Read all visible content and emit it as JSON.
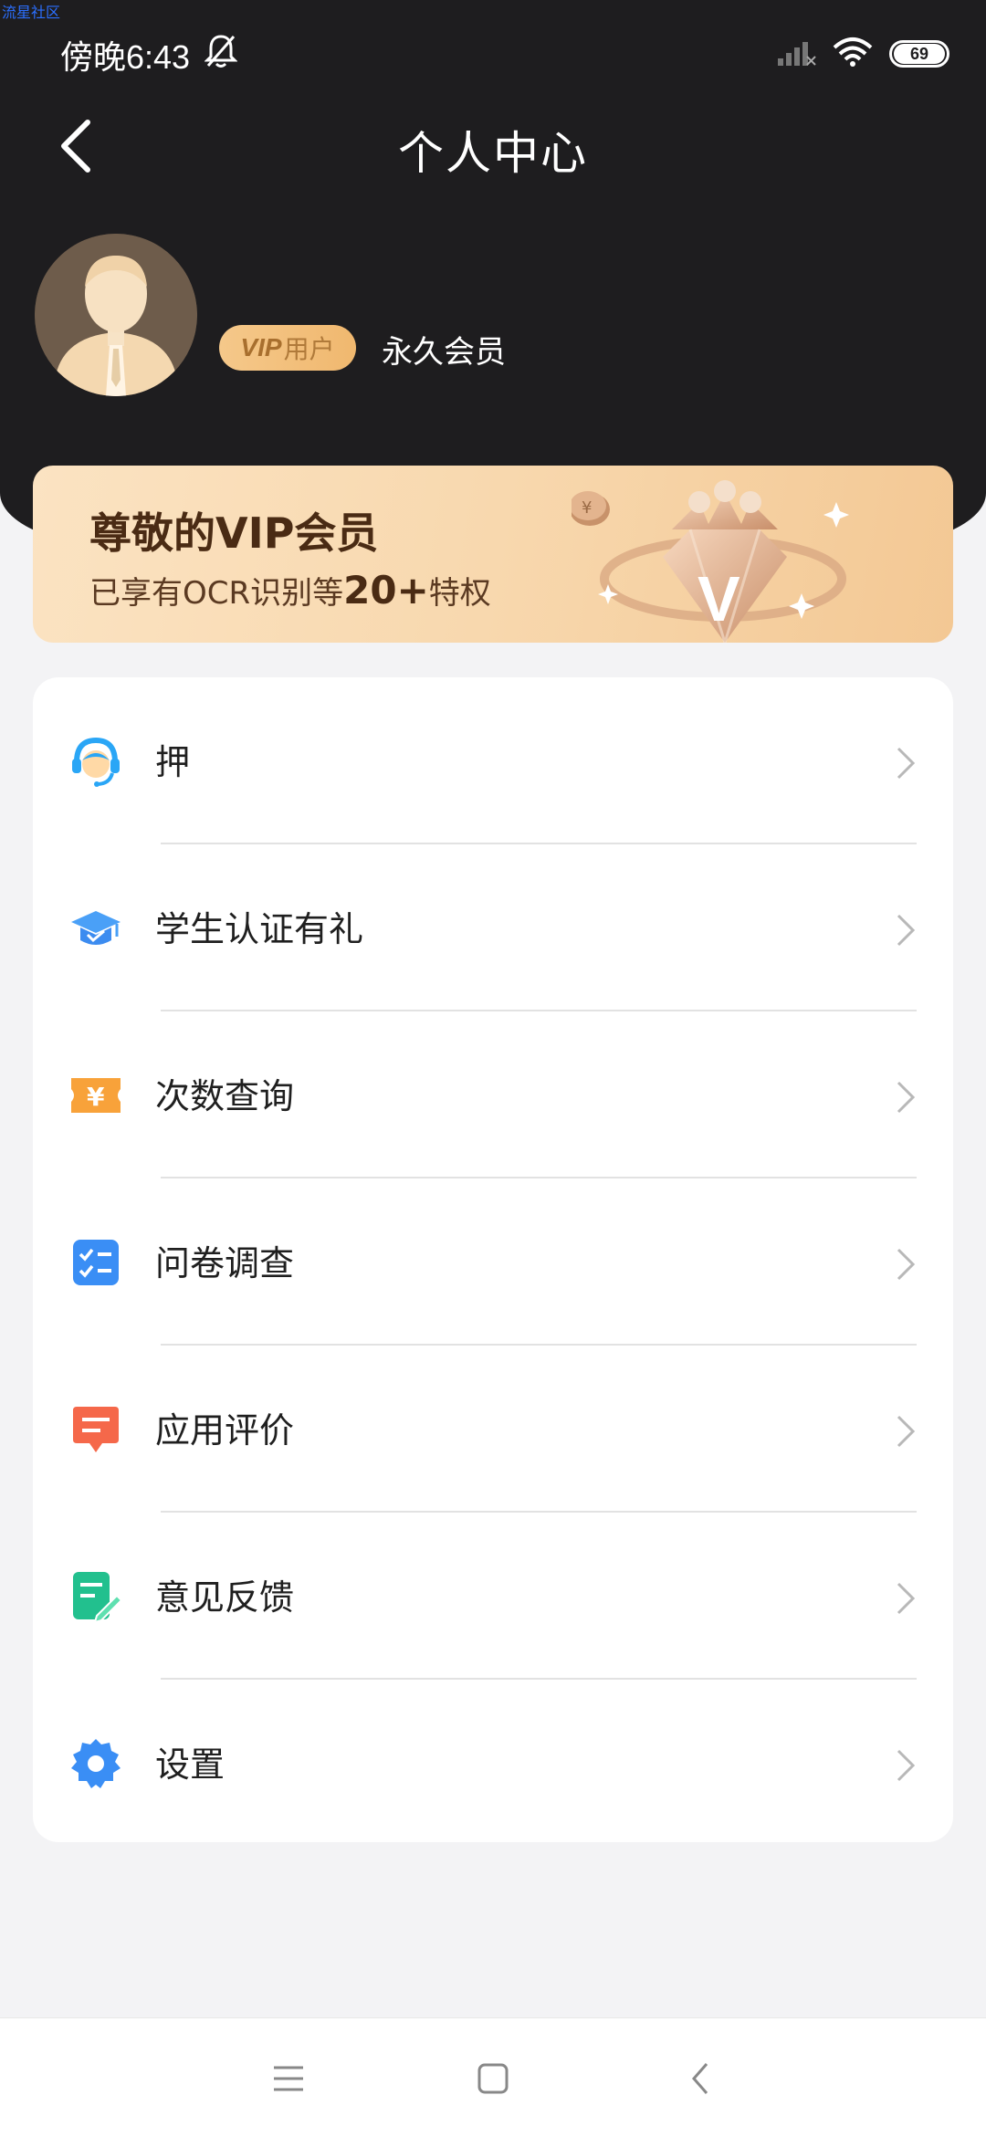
{
  "watermark": "流星社区",
  "status_bar": {
    "time": "傍晚6:43",
    "battery": "69",
    "icons": [
      "bell-off-icon",
      "signal-icon",
      "wifi-icon",
      "battery-icon"
    ]
  },
  "header": {
    "title": "个人中心",
    "back_icon": "back-chevron-icon"
  },
  "profile": {
    "avatar_icon": "user-avatar-icon",
    "vip_badge_prefix": "VIP",
    "vip_badge_suffix": "用户",
    "member_type": "永久会员"
  },
  "vip_banner": {
    "title": "尊敬的VIP会员",
    "subtitle_prefix": "已享有OCR识别等",
    "subtitle_highlight": "20+",
    "subtitle_suffix": "特权"
  },
  "menu": {
    "items": [
      {
        "label": "押",
        "icon": "customer-service-icon",
        "color": "#2aa6f6"
      },
      {
        "label": "学生认证有礼",
        "icon": "graduation-cap-icon",
        "color": "#3c8cf0"
      },
      {
        "label": "次数查询",
        "icon": "yen-ticket-icon",
        "color": "#f8a23a"
      },
      {
        "label": "问卷调查",
        "icon": "checklist-icon",
        "color": "#3a8ef5"
      },
      {
        "label": "应用评价",
        "icon": "comment-icon",
        "color": "#f5684a"
      },
      {
        "label": "意见反馈",
        "icon": "feedback-edit-icon",
        "color": "#22c08e"
      },
      {
        "label": "设置",
        "icon": "gear-icon",
        "color": "#3a8ef5"
      }
    ]
  },
  "system_nav": {
    "icons": [
      "menu-icon",
      "home-square-icon",
      "back-icon"
    ]
  }
}
